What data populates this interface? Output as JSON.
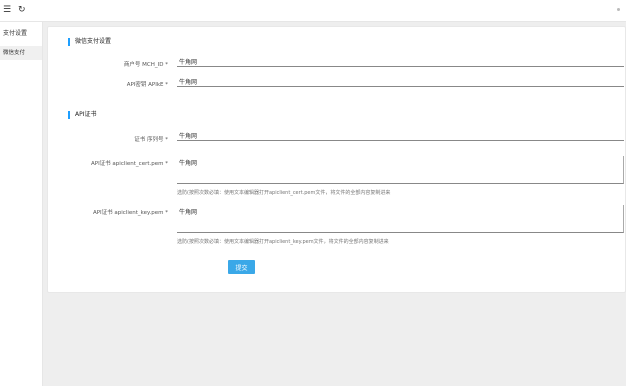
{
  "topbar": {
    "menu_icon": "☰",
    "refresh_icon": "↻"
  },
  "sidebar": {
    "items": [
      {
        "label": "支付设置"
      },
      {
        "label": "微信支付"
      }
    ]
  },
  "form": {
    "section1_title": "微信支付设置",
    "mchid_label": "商户号 MCH_ID *",
    "mchid_value": "牛角网",
    "apikey_label": "API密钥 APIkE *",
    "apikey_value": "牛角网",
    "section2_title": "API证书",
    "serial_label": "证书 序列号 *",
    "serial_value": "牛角网",
    "cert_label": "API证书 apiclient_cert.pem *",
    "cert_value": "牛角网",
    "cert_help": "选防(按照次数必填：使用文本编辑器打开apiclient_cert.pem文件，将文件的全部内容复制进来",
    "key_label": "API证书 apiclient_key.pem *",
    "key_value": "牛角网",
    "key_help": "选防(按照次数必填：使用文本编辑器打开apiclient_key.pem文件，将文件的全部内容复制进来",
    "submit_label": "提交"
  }
}
